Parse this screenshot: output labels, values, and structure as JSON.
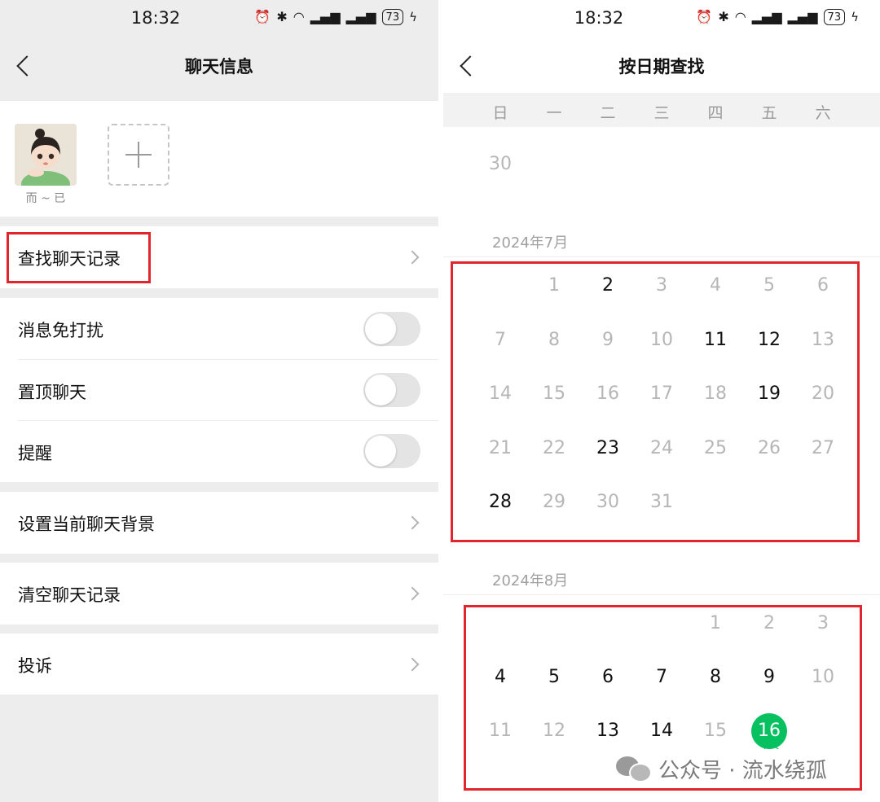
{
  "left": {
    "status": {
      "time": "18:32",
      "battery": "73"
    },
    "title": "聊天信息",
    "member": {
      "name": "而 ~ 已"
    },
    "items": {
      "search_history": "查找聊天记录",
      "mute": "消息免打扰",
      "pin": "置顶聊天",
      "remind": "提醒",
      "background": "设置当前聊天背景",
      "clear": "清空聊天记录",
      "report": "投诉"
    },
    "toggles": {
      "mute": false,
      "pin": false,
      "remind": false
    }
  },
  "right": {
    "status": {
      "time": "18:32",
      "battery": "73"
    },
    "title": "按日期查找",
    "weekdays": [
      "日",
      "一",
      "二",
      "三",
      "四",
      "五",
      "六"
    ],
    "prev_month_tail": "30",
    "july": {
      "title": "2024年7月",
      "days": [
        "1",
        "2",
        "3",
        "4",
        "5",
        "6",
        "7",
        "8",
        "9",
        "10",
        "11",
        "12",
        "13",
        "14",
        "15",
        "16",
        "17",
        "18",
        "19",
        "20",
        "21",
        "22",
        "23",
        "24",
        "25",
        "26",
        "27",
        "28",
        "29",
        "30",
        "31"
      ],
      "active_days": [
        "2",
        "11",
        "12",
        "19",
        "23",
        "28"
      ]
    },
    "august": {
      "title": "2024年8月",
      "days": [
        "1",
        "2",
        "3",
        "4",
        "5",
        "6",
        "7",
        "8",
        "9",
        "10",
        "11",
        "12",
        "13",
        "14",
        "15",
        "16"
      ],
      "active_days": [
        "4",
        "5",
        "6",
        "7",
        "8",
        "9",
        "13",
        "14"
      ],
      "today": "16",
      "today_label": "今天"
    },
    "colors": {
      "accent": "#07c160",
      "highlight_box": "#e0252d"
    }
  },
  "watermark": "公众号 · 流水绕孤"
}
